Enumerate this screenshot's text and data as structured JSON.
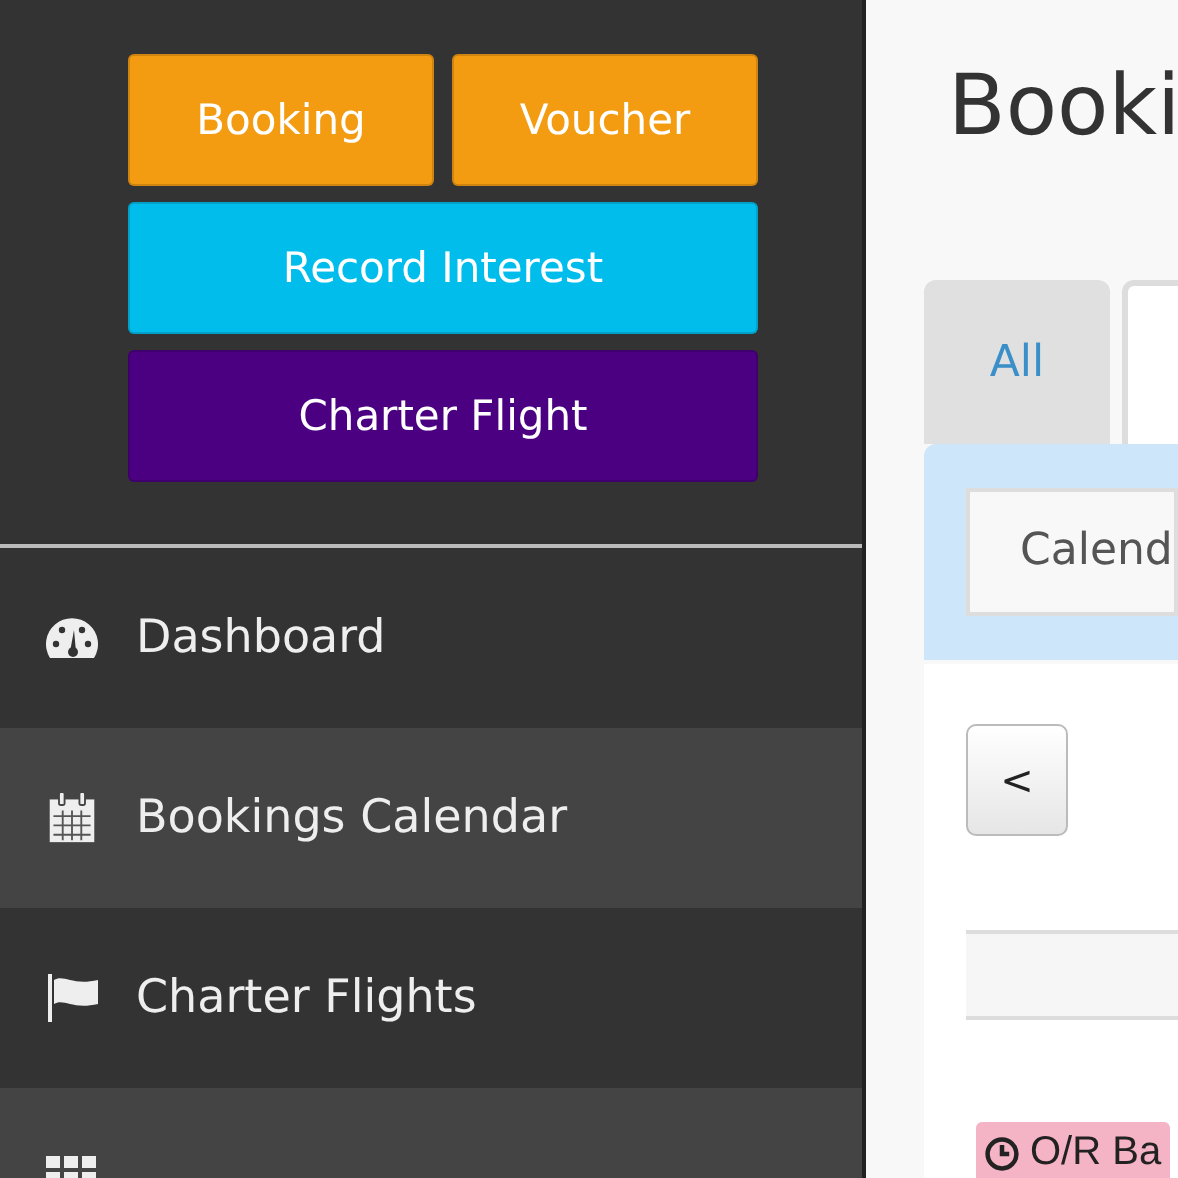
{
  "quick_actions": [
    {
      "label": "Booking",
      "kind": "orange"
    },
    {
      "label": "Voucher",
      "kind": "orange"
    },
    {
      "label": "Record Interest",
      "kind": "cyan"
    },
    {
      "label": "Charter Flight",
      "kind": "purple"
    }
  ],
  "sidebar": {
    "items": [
      {
        "label": "Dashboard",
        "kind": "gauge",
        "selected": false
      },
      {
        "label": "Bookings Calendar",
        "kind": "calendar",
        "selected": true
      },
      {
        "label": "Charter Flights",
        "kind": "flag",
        "selected": false
      },
      {
        "kind": "grid",
        "selected": true
      }
    ]
  },
  "page": {
    "title": "Booki",
    "tabs": [
      {
        "label": "All",
        "selected": false
      },
      {
        "selected": true
      }
    ],
    "filter": {
      "value": "Calend"
    },
    "prev_button": "<",
    "event_badge": {
      "label": "O/R Ba",
      "color": "#f5b3c6"
    }
  }
}
